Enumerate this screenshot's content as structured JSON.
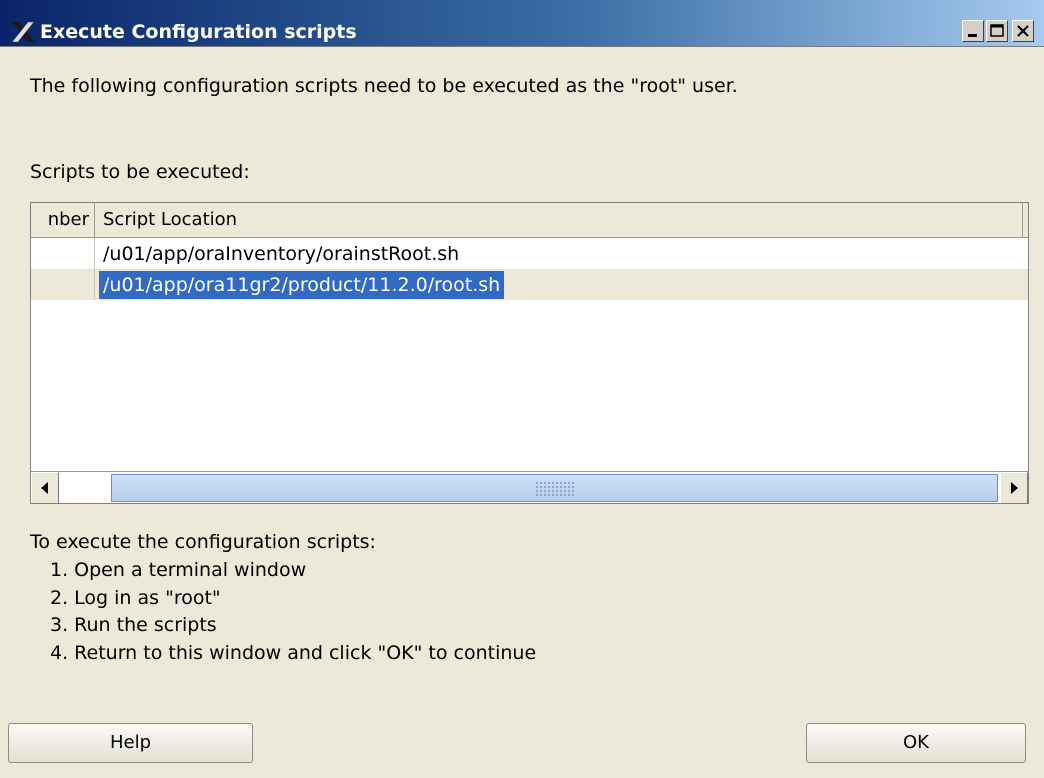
{
  "window": {
    "title": "Execute Configuration scripts",
    "title_icon": "x-window-icon",
    "controls": [
      "minimize-icon",
      "maximize-icon",
      "close-icon"
    ]
  },
  "intro_text": "The following configuration scripts need to be executed as the \"root\" user.",
  "scripts_label": "Scripts to be executed:",
  "table": {
    "columns": [
      "nber",
      "Script Location"
    ],
    "rows": [
      {
        "number": "",
        "location": "/u01/app/oraInventory/orainstRoot.sh",
        "selected": false
      },
      {
        "number": "",
        "location": "/u01/app/ora11gr2/product/11.2.0/root.sh",
        "selected": true
      }
    ]
  },
  "instructions": {
    "title": "To execute the configuration scripts:",
    "steps": [
      "1. Open a terminal window",
      "2. Log in as \"root\"",
      "3. Run the scripts",
      "4. Return to this window and click \"OK\" to continue"
    ]
  },
  "buttons": {
    "help": "Help",
    "ok": "OK"
  },
  "colors": {
    "selection": "#316ac5",
    "dialog_bg": "#ece9d8",
    "titlebar_start": "#0a246a"
  }
}
